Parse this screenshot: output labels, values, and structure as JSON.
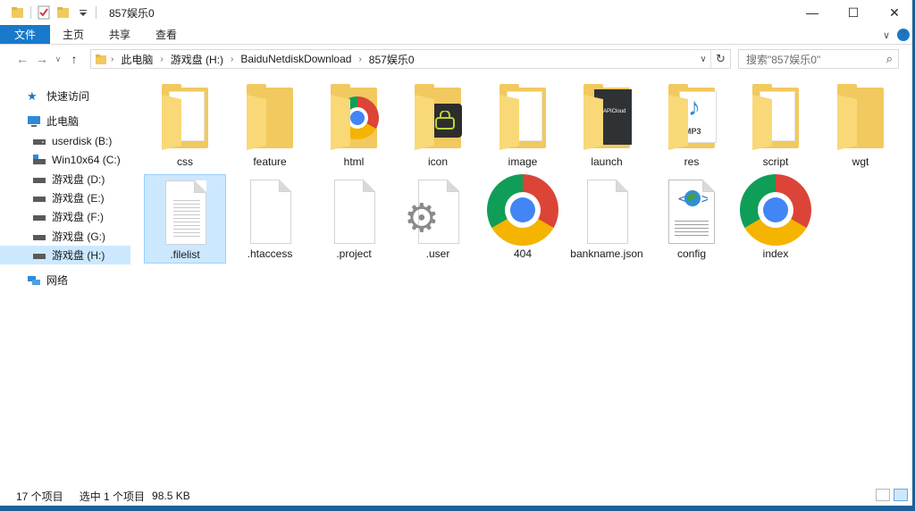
{
  "window": {
    "title": "857娱乐0",
    "minimize": "—",
    "maximize": "☐",
    "close": "✕"
  },
  "ribbon": {
    "tabs": [
      "文件",
      "主页",
      "共享",
      "查看"
    ],
    "expand": "∨",
    "help": "?"
  },
  "address": {
    "crumbs": [
      "此电脑",
      "游戏盘 (H:)",
      "BaiduNetdiskDownload",
      "857娱乐0"
    ],
    "search_placeholder": "搜索\"857娱乐0\""
  },
  "nav": {
    "items": [
      {
        "label": "快速访问",
        "icon": "star-icon"
      },
      {
        "label": "此电脑",
        "icon": "computer-icon"
      },
      {
        "label": "userdisk (B:)",
        "icon": "drive-icon"
      },
      {
        "label": "Win10x64 (C:)",
        "icon": "system-drive-icon"
      },
      {
        "label": "游戏盘 (D:)",
        "icon": "drive-icon"
      },
      {
        "label": "游戏盘 (E:)",
        "icon": "drive-icon"
      },
      {
        "label": "游戏盘 (F:)",
        "icon": "drive-icon"
      },
      {
        "label": "游戏盘 (G:)",
        "icon": "drive-icon"
      },
      {
        "label": "游戏盘 (H:)",
        "icon": "drive-icon",
        "selected": true
      },
      {
        "label": "网络",
        "icon": "network-icon"
      }
    ]
  },
  "files": [
    {
      "name": "css",
      "type": "folder"
    },
    {
      "name": "feature",
      "type": "folder"
    },
    {
      "name": "html",
      "type": "folder-chrome"
    },
    {
      "name": "icon",
      "type": "folder-icon"
    },
    {
      "name": "image",
      "type": "folder"
    },
    {
      "name": "launch",
      "type": "folder-dark",
      "logo_text": "APICloud"
    },
    {
      "name": "res",
      "type": "folder-mp3",
      "badge": "MP3"
    },
    {
      "name": "script",
      "type": "folder"
    },
    {
      "name": "wgt",
      "type": "folder"
    },
    {
      "name": ".filelist",
      "type": "doc-lines",
      "selected": true
    },
    {
      "name": ".htaccess",
      "type": "doc"
    },
    {
      "name": ".project",
      "type": "doc"
    },
    {
      "name": ".user",
      "type": "doc-gear"
    },
    {
      "name": "404",
      "type": "chrome"
    },
    {
      "name": "bankname.json",
      "type": "doc"
    },
    {
      "name": "config",
      "type": "xml"
    },
    {
      "name": "index",
      "type": "chrome"
    }
  ],
  "status": {
    "count": "17 个项目",
    "selection": "选中 1 个项目",
    "size": "98.5 KB"
  },
  "colors": {
    "accent": "#1979ca",
    "selection_bg": "#cce8ff",
    "folder": "#f1c95f"
  }
}
